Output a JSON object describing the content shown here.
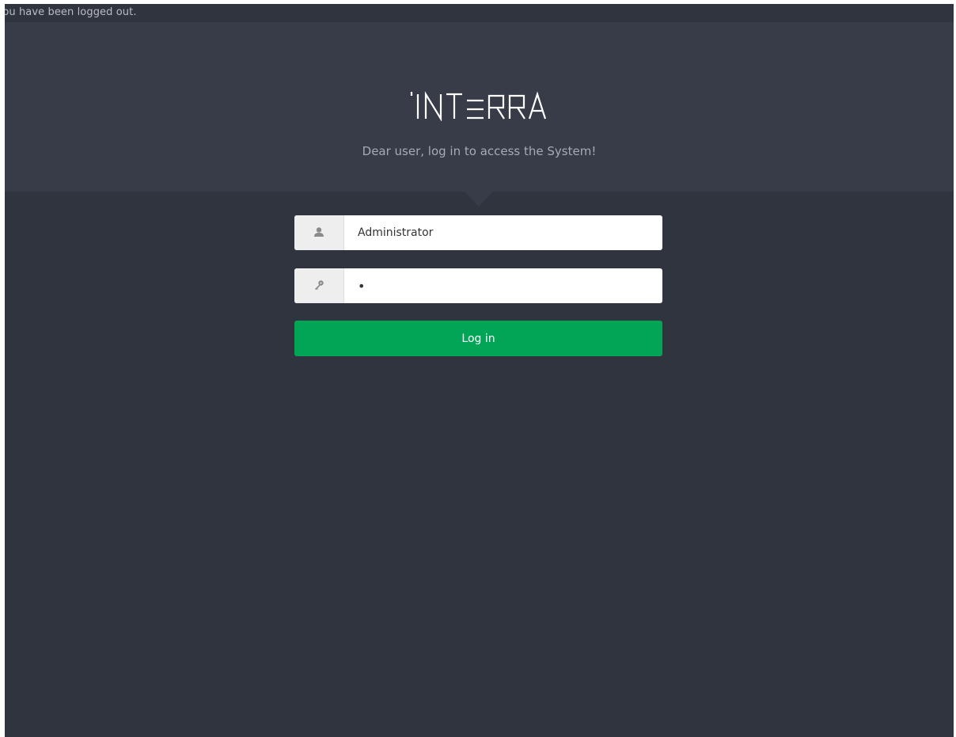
{
  "notice": {
    "text": "You have been logged out."
  },
  "header": {
    "logo_text": "INTERRA",
    "subtitle": "Dear user, log in to access the System!"
  },
  "login_form": {
    "username": {
      "value": "Administrator",
      "icon": "user-icon"
    },
    "password": {
      "value": "•",
      "icon": "key-icon"
    },
    "submit_label": "Log in"
  },
  "colors": {
    "page_background": "#30343f",
    "header_background": "#373c48",
    "button_green": "#02a555"
  }
}
